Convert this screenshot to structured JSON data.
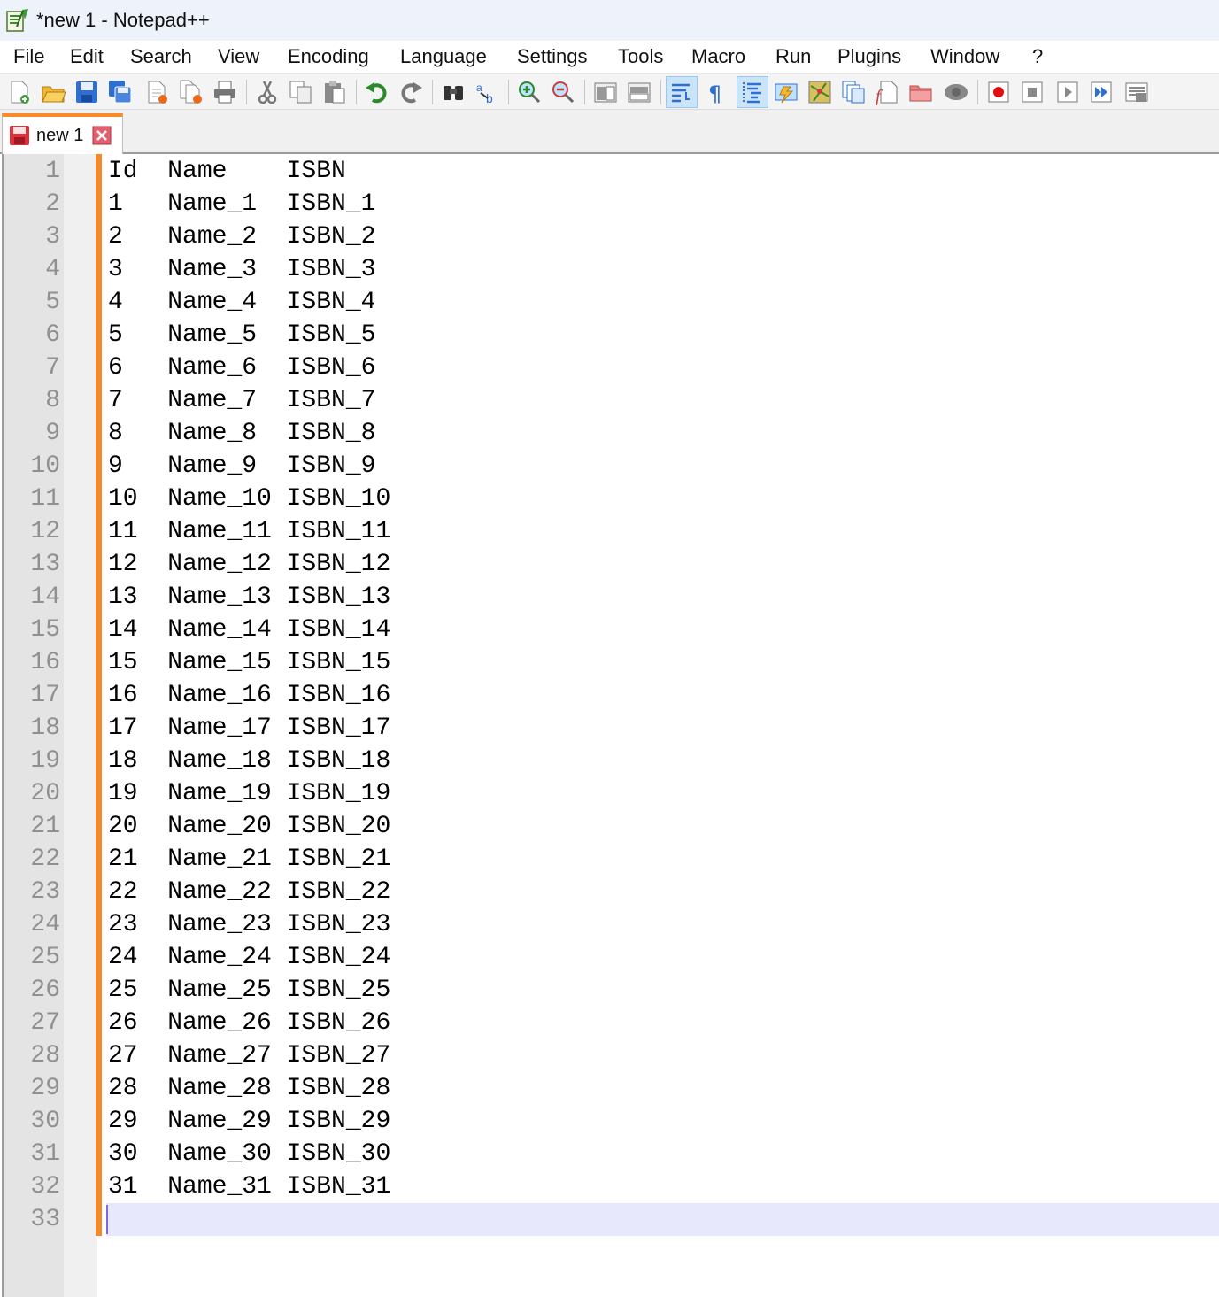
{
  "window": {
    "title": "*new 1 - Notepad++"
  },
  "menu": [
    "File",
    "Edit",
    "Search",
    "View",
    "Encoding",
    "Language",
    "Settings",
    "Tools",
    "Macro",
    "Run",
    "Plugins",
    "Window",
    "?"
  ],
  "toolbar": {
    "buttons": [
      {
        "icon": "new-file-icon"
      },
      {
        "icon": "open-file-icon"
      },
      {
        "icon": "save-icon"
      },
      {
        "icon": "save-all-icon"
      },
      {
        "icon": "close-icon"
      },
      {
        "icon": "close-all-icon"
      },
      {
        "icon": "print-icon"
      },
      {
        "icon": "cut-icon"
      },
      {
        "icon": "copy-icon"
      },
      {
        "icon": "paste-icon"
      },
      {
        "icon": "undo-icon"
      },
      {
        "icon": "redo-icon"
      },
      {
        "icon": "find-icon"
      },
      {
        "icon": "replace-icon"
      },
      {
        "icon": "zoom-in-icon"
      },
      {
        "icon": "zoom-out-icon"
      },
      {
        "icon": "sync-vertical-icon"
      },
      {
        "icon": "sync-horizontal-icon"
      },
      {
        "icon": "word-wrap-icon"
      },
      {
        "icon": "show-all-characters-icon"
      },
      {
        "icon": "indent-guide-icon"
      },
      {
        "icon": "user-defined-language-icon"
      },
      {
        "icon": "document-map-icon"
      },
      {
        "icon": "document-list-icon"
      },
      {
        "icon": "function-list-icon"
      },
      {
        "icon": "folder-as-workspace-icon"
      },
      {
        "icon": "monitoring-icon"
      },
      {
        "icon": "record-macro-icon"
      },
      {
        "icon": "stop-recording-icon"
      },
      {
        "icon": "playback-macro-icon"
      },
      {
        "icon": "run-macro-multiple-icon"
      },
      {
        "icon": "save-macro-icon"
      }
    ]
  },
  "tabs": [
    {
      "label": "new 1",
      "modified": true
    }
  ],
  "editor": {
    "current_line": 33,
    "lines": [
      "Id  Name    ISBN",
      "1   Name_1  ISBN_1",
      "2   Name_2  ISBN_2",
      "3   Name_3  ISBN_3",
      "4   Name_4  ISBN_4",
      "5   Name_5  ISBN_5",
      "6   Name_6  ISBN_6",
      "7   Name_7  ISBN_7",
      "8   Name_8  ISBN_8",
      "9   Name_9  ISBN_9",
      "10  Name_10 ISBN_10",
      "11  Name_11 ISBN_11",
      "12  Name_12 ISBN_12",
      "13  Name_13 ISBN_13",
      "14  Name_14 ISBN_14",
      "15  Name_15 ISBN_15",
      "16  Name_16 ISBN_16",
      "17  Name_17 ISBN_17",
      "18  Name_18 ISBN_18",
      "19  Name_19 ISBN_19",
      "20  Name_20 ISBN_20",
      "21  Name_21 ISBN_21",
      "22  Name_22 ISBN_22",
      "23  Name_23 ISBN_23",
      "24  Name_24 ISBN_24",
      "25  Name_25 ISBN_25",
      "26  Name_26 ISBN_26",
      "27  Name_27 ISBN_27",
      "28  Name_28 ISBN_28",
      "29  Name_29 ISBN_29",
      "30  Name_30 ISBN_30",
      "31  Name_31 ISBN_31",
      ""
    ]
  },
  "colors": {
    "change_bar": "#f08a2c",
    "tab_accent": "#fa8b2d",
    "current_line_bg": "#e8e8fc",
    "line_number": "#909090"
  }
}
